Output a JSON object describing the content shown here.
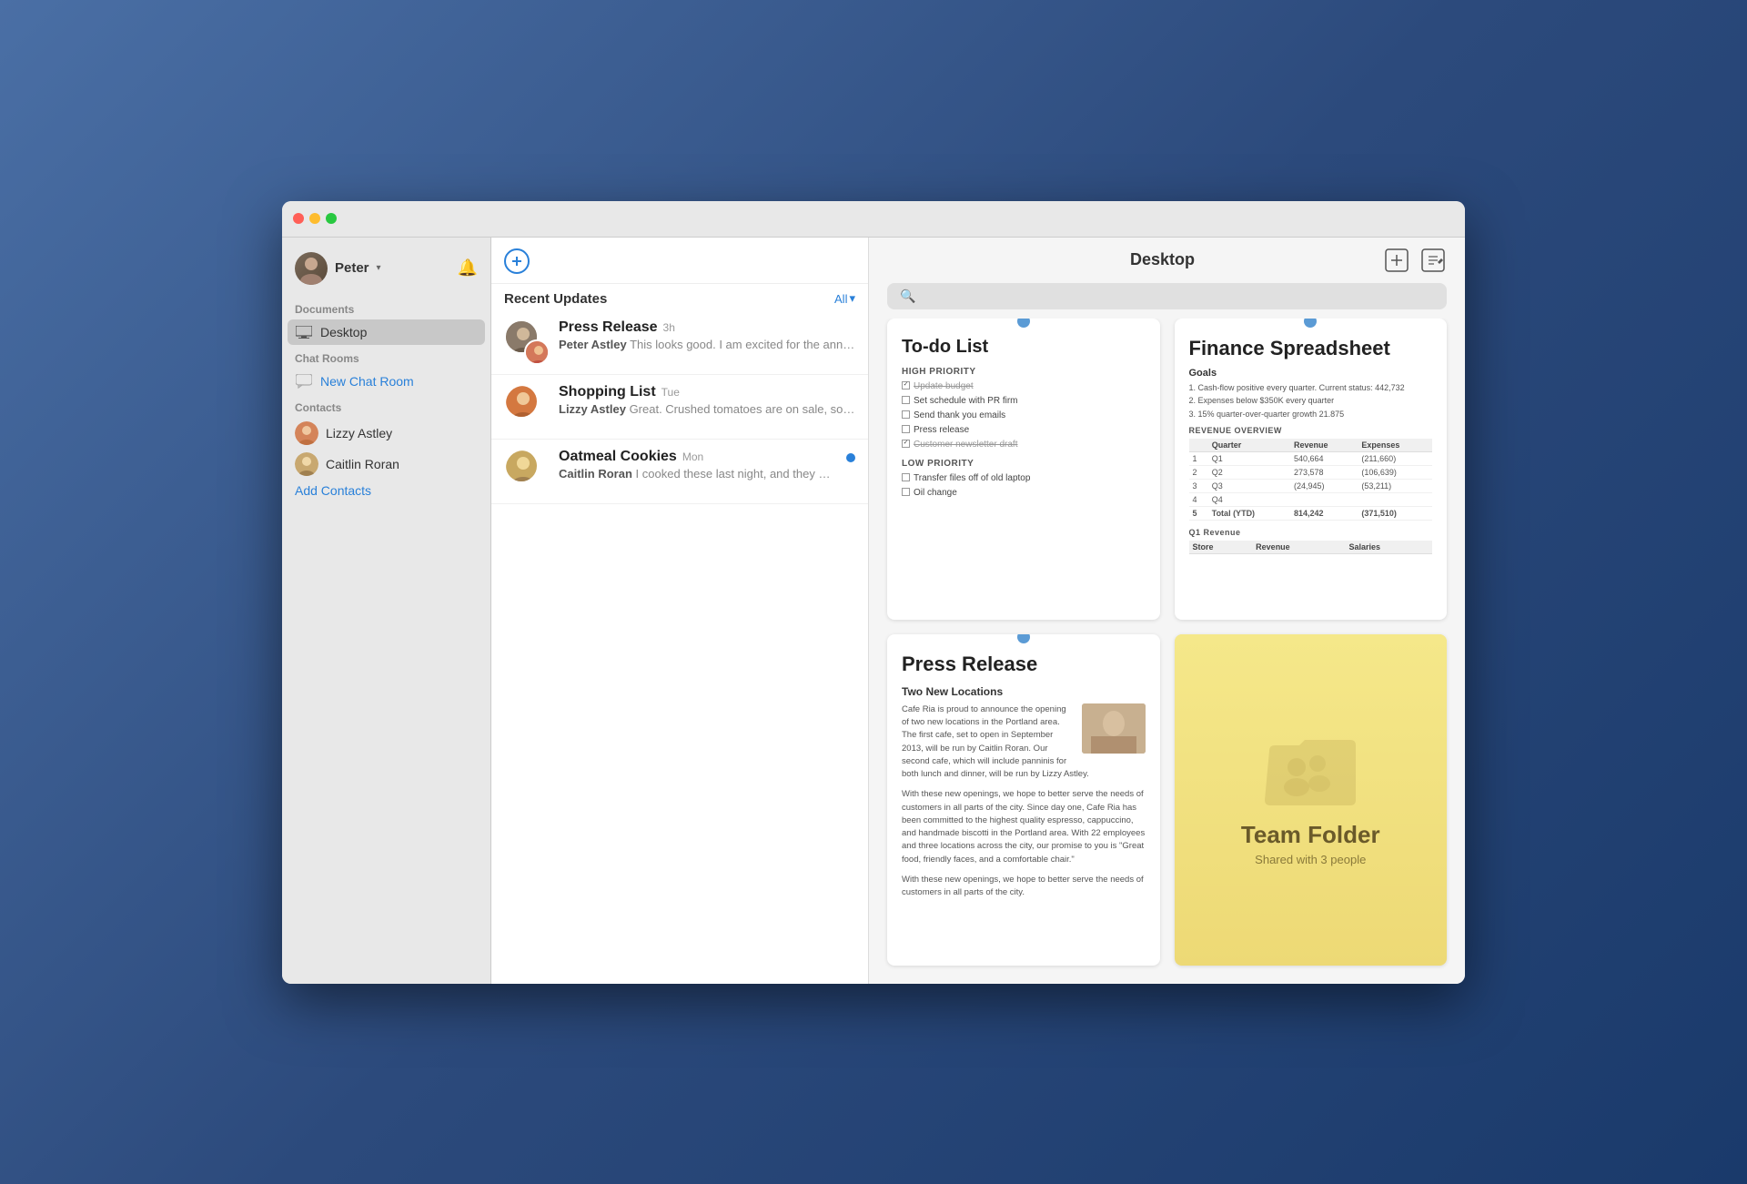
{
  "window": {
    "title": "Desktop"
  },
  "sidebar": {
    "user": {
      "name": "Peter",
      "chevron": "▾"
    },
    "documents_section": "Documents",
    "desktop_label": "Desktop",
    "chat_rooms_section": "Chat Rooms",
    "new_chat_room_label": "New Chat Room",
    "contacts_section": "Contacts",
    "contacts": [
      {
        "name": "Lizzy Astley"
      },
      {
        "name": "Caitlin Roran"
      }
    ],
    "add_contacts_label": "Add Contacts"
  },
  "chat_pane": {
    "section_title": "Recent Updates",
    "all_label": "All",
    "items": [
      {
        "name": "Press Release",
        "time": "3h",
        "sender": "Peter Astley",
        "preview": "This looks good. I am excited for the announcement…"
      },
      {
        "name": "Shopping List",
        "time": "Tue",
        "sender": "Lizzy Astley",
        "preview": "Great. Crushed tomatoes are on sale, so I will get those."
      },
      {
        "name": "Oatmeal Cookies",
        "time": "Mon",
        "sender": "Caitlin Roran",
        "preview": "I cooked these last night, and they were great. Let me…",
        "unread": true
      }
    ]
  },
  "desktop": {
    "title": "Desktop",
    "search_placeholder": "",
    "cards": {
      "todo": {
        "title": "To-do List",
        "high_priority_label": "HIGH PRIORITY",
        "high_priority_items": [
          {
            "text": "Update budget",
            "done": true
          },
          {
            "text": "Set schedule with PR firm",
            "done": false
          },
          {
            "text": "Send thank you emails",
            "done": false
          },
          {
            "text": "Press release",
            "done": false
          },
          {
            "text": "Customer newsletter draft",
            "done": true
          }
        ],
        "low_priority_label": "LOW PRIORITY",
        "low_priority_items": [
          {
            "text": "Transfer files off of old laptop",
            "done": false
          },
          {
            "text": "Oil change",
            "done": false
          }
        ]
      },
      "finance": {
        "title": "Finance Spreadsheet",
        "goals_label": "Goals",
        "goals": [
          "Cash-flow positive every quarter. Current status: 442,732",
          "Expenses below $350K every quarter",
          "15% quarter-over-quarter growth 21.875"
        ],
        "revenue_label": "REVENUE OVERVIEW",
        "table_headers": [
          "",
          "Quarter",
          "Revenue",
          "Expenses"
        ],
        "table_rows": [
          [
            "1",
            "Q1",
            "540,664",
            "(211,660)"
          ],
          [
            "2",
            "Q2",
            "273,578",
            "(106,639)"
          ],
          [
            "3",
            "Q3",
            "(24,945)",
            "(53,211)"
          ],
          [
            "4",
            "Q4",
            "",
            ""
          ],
          [
            "5",
            "Total (YTD)",
            "814,242",
            "(371,510)"
          ]
        ],
        "q1_revenue_label": "Q1 Revenue",
        "q1_sub_headers": [
          "Store",
          "Revenue",
          "Salaries"
        ]
      },
      "press_release": {
        "title": "Press Release",
        "subtitle": "Two New Locations",
        "body1": "Cafe Ria is proud to announce the opening of two new locations in the Portland area. The first cafe, set to open in September 2013, will be run by Caitlin Roran. Our second cafe, which will include panninis for both lunch and dinner, will be run by Lizzy Astley.",
        "body2": "With these new openings, we hope to better serve the needs of customers in all parts of the city. Since day one, Cafe Ria has been committed to the highest quality espresso, cappuccino, and handmade biscotti in the Portland area. With 22 employees and three locations across the city, our promise to you is \"Great food, friendly faces, and a comfortable chair.\"",
        "body3": "With these new openings, we hope to better serve the needs of customers in all parts of the city."
      },
      "team_folder": {
        "title": "Team Folder",
        "subtitle": "Shared with 3 people"
      }
    }
  }
}
